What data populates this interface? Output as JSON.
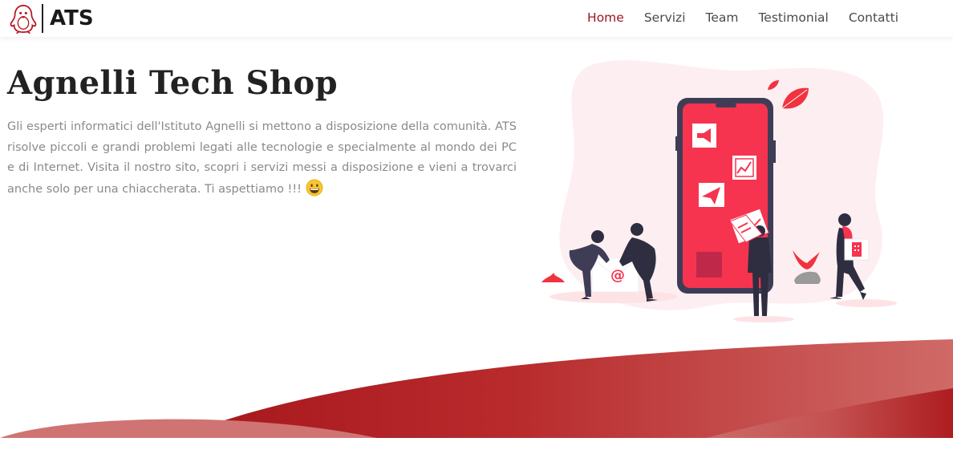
{
  "brand": {
    "logo_icon": "penguin-logo-icon",
    "name": "ATS"
  },
  "nav": {
    "items": [
      {
        "label": "Home",
        "active": true
      },
      {
        "label": "Servizi",
        "active": false
      },
      {
        "label": "Team",
        "active": false
      },
      {
        "label": "Testimonial",
        "active": false
      },
      {
        "label": "Contatti",
        "active": false
      }
    ]
  },
  "hero": {
    "title": "Agnelli Tech Shop",
    "description": "Gli esperti informatici dell'Istituto Agnelli si mettono a disposizione della comunità. ATS risolve piccoli e grandi problemi legati alle tecnologie e specialmente al mondo dei PC e di Internet. Visita il nostro sito, scopri i servizi messi a disposizione e vieni a trovarci anche solo per una chiaccherata. Ti aspettiamo !!!",
    "emoji_icon": "grinning-face-icon",
    "illustration_icons": [
      "megaphone-icon",
      "chart-icon",
      "paper-plane-icon",
      "at-sign-icon",
      "building-icon",
      "leaf-icon"
    ]
  },
  "colors": {
    "accent": "#9e1620",
    "phone_screen": "#f6344f",
    "phone_frame": "#3f3d56",
    "wave_dark": "#ac1a1f",
    "wave_light": "#c8605f",
    "blob": "#fdeff1"
  }
}
